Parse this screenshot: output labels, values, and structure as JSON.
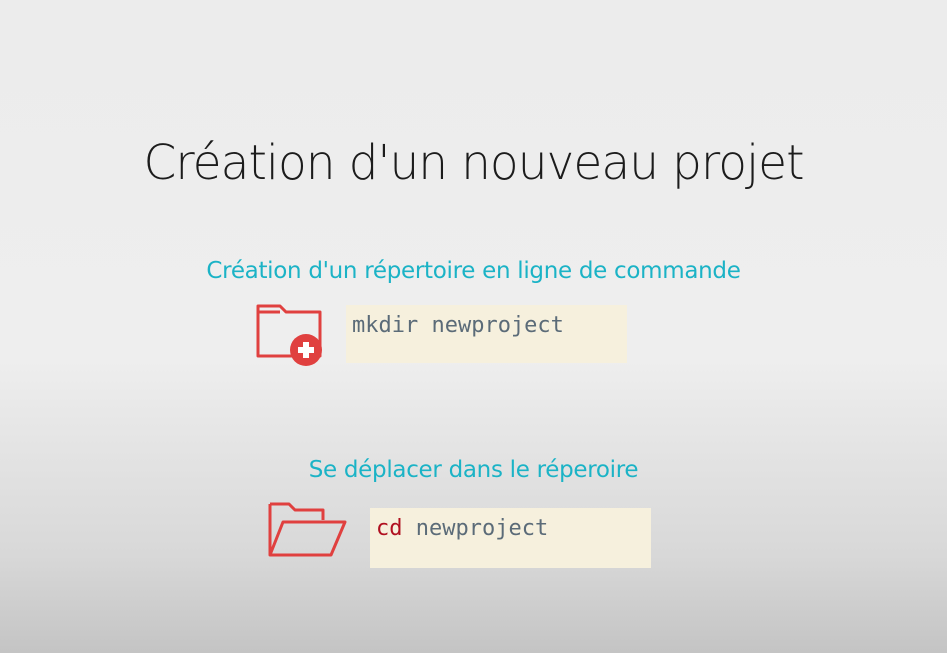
{
  "slide": {
    "title": "Création d'un nouveau projet"
  },
  "sections": [
    {
      "heading": "Création d'un répertoire en ligne de commande",
      "icon": "folder-add-icon",
      "command": "mkdir newproject"
    },
    {
      "heading": "Se déplacer dans  le réperoire",
      "icon": "folder-open-icon",
      "command_keyword": "cd",
      "command_arg": " newproject"
    }
  ],
  "colors": {
    "heading": "#1bb3c6",
    "icon": "#e0403f",
    "code_background": "#f6f0dd",
    "code_text": "#5b6b78",
    "code_keyword": "#b01020"
  }
}
